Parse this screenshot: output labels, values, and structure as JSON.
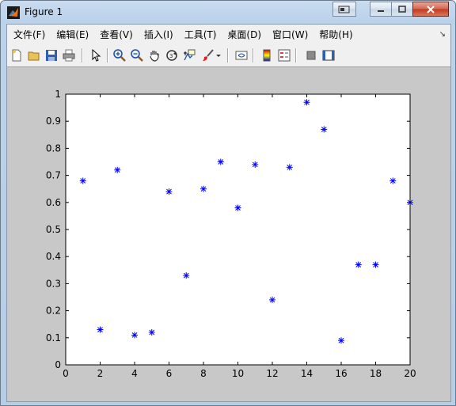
{
  "window": {
    "title": "Figure 1"
  },
  "menubar": {
    "items": [
      {
        "label": "文件(F)"
      },
      {
        "label": "编辑(E)"
      },
      {
        "label": "查看(V)"
      },
      {
        "label": "插入(I)"
      },
      {
        "label": "工具(T)"
      },
      {
        "label": "桌面(D)"
      },
      {
        "label": "窗口(W)"
      },
      {
        "label": "帮助(H)"
      }
    ]
  },
  "toolbar": {
    "tools": [
      "new-file-icon",
      "open-folder-icon",
      "save-icon",
      "print-icon",
      "pointer-icon",
      "zoom-in-icon",
      "zoom-out-icon",
      "pan-hand-icon",
      "rotate-3d-icon",
      "data-cursor-icon",
      "brush-icon",
      "brush-dropdown-icon",
      "link-plot-icon",
      "colorbar-icon",
      "legend-icon",
      "hide-plot-tools-icon",
      "show-plot-tools-icon"
    ]
  },
  "chart_data": {
    "type": "scatter",
    "marker": "*",
    "color": "#0000ff",
    "x": [
      1,
      2,
      3,
      4,
      5,
      6,
      7,
      8,
      9,
      10,
      11,
      12,
      13,
      14,
      15,
      16,
      17,
      18,
      19,
      20
    ],
    "y": [
      0.68,
      0.13,
      0.72,
      0.11,
      0.12,
      0.64,
      0.33,
      0.65,
      0.75,
      0.58,
      0.74,
      0.24,
      0.73,
      0.97,
      0.87,
      0.09,
      0.37,
      0.37,
      0.68,
      0.6
    ],
    "xlim": [
      0,
      20
    ],
    "ylim": [
      0,
      1
    ],
    "xticks": [
      "0",
      "2",
      "4",
      "6",
      "8",
      "10",
      "12",
      "14",
      "16",
      "18",
      "20"
    ],
    "yticks": [
      "0",
      "0.1",
      "0.2",
      "0.3",
      "0.4",
      "0.5",
      "0.6",
      "0.7",
      "0.8",
      "0.9",
      "1"
    ],
    "grid": false,
    "title": "",
    "xlabel": "",
    "ylabel": ""
  }
}
